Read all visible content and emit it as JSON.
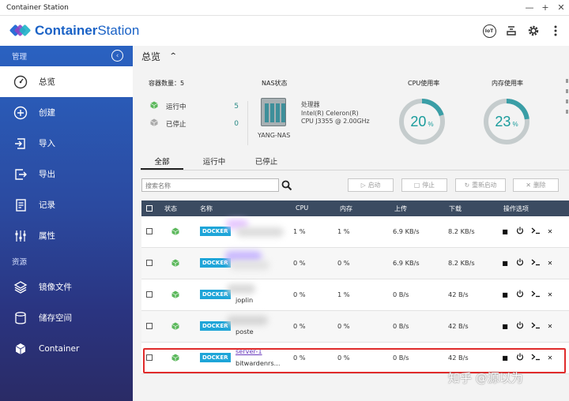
{
  "window": {
    "title": "Container Station",
    "controls": [
      "—",
      "+",
      "✕"
    ]
  },
  "header": {
    "logo_bold": "Container",
    "logo_rest": "Station",
    "icons": [
      "iot-icon",
      "stack-icon",
      "gear-icon",
      "more-icon"
    ]
  },
  "sidebar": {
    "section_manage": "管理",
    "section_resources": "资源",
    "items": [
      {
        "label": "总览",
        "icon": "dashboard-icon"
      },
      {
        "label": "创建",
        "icon": "plus-circle-icon"
      },
      {
        "label": "导入",
        "icon": "import-icon"
      },
      {
        "label": "导出",
        "icon": "export-icon"
      },
      {
        "label": "记录",
        "icon": "log-icon"
      },
      {
        "label": "属性",
        "icon": "sliders-icon"
      }
    ],
    "resource_items": [
      {
        "label": "镜像文件",
        "icon": "layers-icon"
      },
      {
        "label": "储存空间",
        "icon": "database-icon"
      },
      {
        "label": "Container",
        "icon": "cube-icon"
      }
    ]
  },
  "overview": {
    "title": "总览",
    "container_count_label": "容器数量：",
    "container_count": "5",
    "running_label": "运行中",
    "running_count": "5",
    "stopped_label": "已停止",
    "stopped_count": "0",
    "nas_title": "NAS状态",
    "nas_name": "YANG-NAS",
    "processor_label": "处理器",
    "processor_line1": "Intel(R) Celeron(R)",
    "processor_line2": "CPU J3355 @ 2.00GHz",
    "cpu_title": "CPU使用率",
    "cpu_value": "20",
    "cpu_pct": 20,
    "mem_title": "内存使用率",
    "mem_value": "23",
    "mem_pct": 23,
    "percent_sign": "%"
  },
  "tabs": [
    "全部",
    "运行中",
    "已停止"
  ],
  "search": {
    "placeholder": "搜索名称"
  },
  "actions": [
    "启动",
    "停止",
    "重新启动",
    "删除"
  ],
  "table": {
    "headers": [
      "状态",
      "名称",
      "CPU",
      "内存",
      "上传",
      "下载",
      "操作选项"
    ],
    "rows": [
      {
        "badge": "DOCKER",
        "name1": "",
        "name2": "",
        "cpu": "1 %",
        "mem": "1 %",
        "up": "6.9 KB/s",
        "down": "8.2 KB/s"
      },
      {
        "badge": "DOCKER",
        "name1": "",
        "name2": "",
        "cpu": "0 %",
        "mem": "0 %",
        "up": "6.9 KB/s",
        "down": "8.2 KB/s"
      },
      {
        "badge": "DOCKER",
        "name1": "",
        "name2": "joplin",
        "cpu": "0 %",
        "mem": "1 %",
        "up": "0 B/s",
        "down": "42 B/s"
      },
      {
        "badge": "DOCKER",
        "name1": "",
        "name2": "poste",
        "cpu": "0 %",
        "mem": "0 %",
        "up": "0 B/s",
        "down": "42 B/s"
      },
      {
        "badge": "DOCKER",
        "name1": "server-1",
        "name2": "bitwardenrs...",
        "cpu": "0 %",
        "mem": "0 %",
        "up": "0 B/s",
        "down": "42 B/s"
      }
    ]
  },
  "watermark": "知乎 @源以为",
  "colors": {
    "accent": "#1a9c9c",
    "sidebar_top": "#2a62c1",
    "sidebar_bottom": "#2a2b66",
    "table_header": "#3b4b61",
    "docker_badge": "#1ea5d8",
    "highlight": "#e02b2b"
  }
}
